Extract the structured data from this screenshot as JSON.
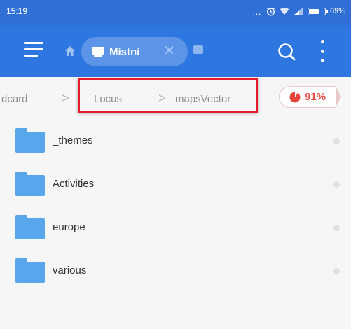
{
  "status_bar": {
    "time": "15:19",
    "battery_level": "69%",
    "battery_fraction": 0.69
  },
  "toolbar": {
    "menu_icon": "hamburger-menu-icon",
    "home_icon": "home-icon",
    "active_tab_label": "Místní",
    "active_tab_icon": "disk-icon",
    "close_icon": "close-icon",
    "search_icon": "search-icon",
    "more_icon": "more-vertical-icon",
    "accent_color": "#2f77e0"
  },
  "breadcrumb": {
    "items": [
      "dcard",
      "Locus",
      "mapsVector"
    ],
    "separator": ">",
    "storage_used": "91%",
    "storage_fraction": 0.91,
    "storage_color": "#e8453c",
    "highlight_color": "#e31b2b"
  },
  "files": [
    {
      "name": "_themes",
      "type": "folder"
    },
    {
      "name": "Activities",
      "type": "folder"
    },
    {
      "name": "europe",
      "type": "folder"
    },
    {
      "name": "various",
      "type": "folder"
    }
  ]
}
